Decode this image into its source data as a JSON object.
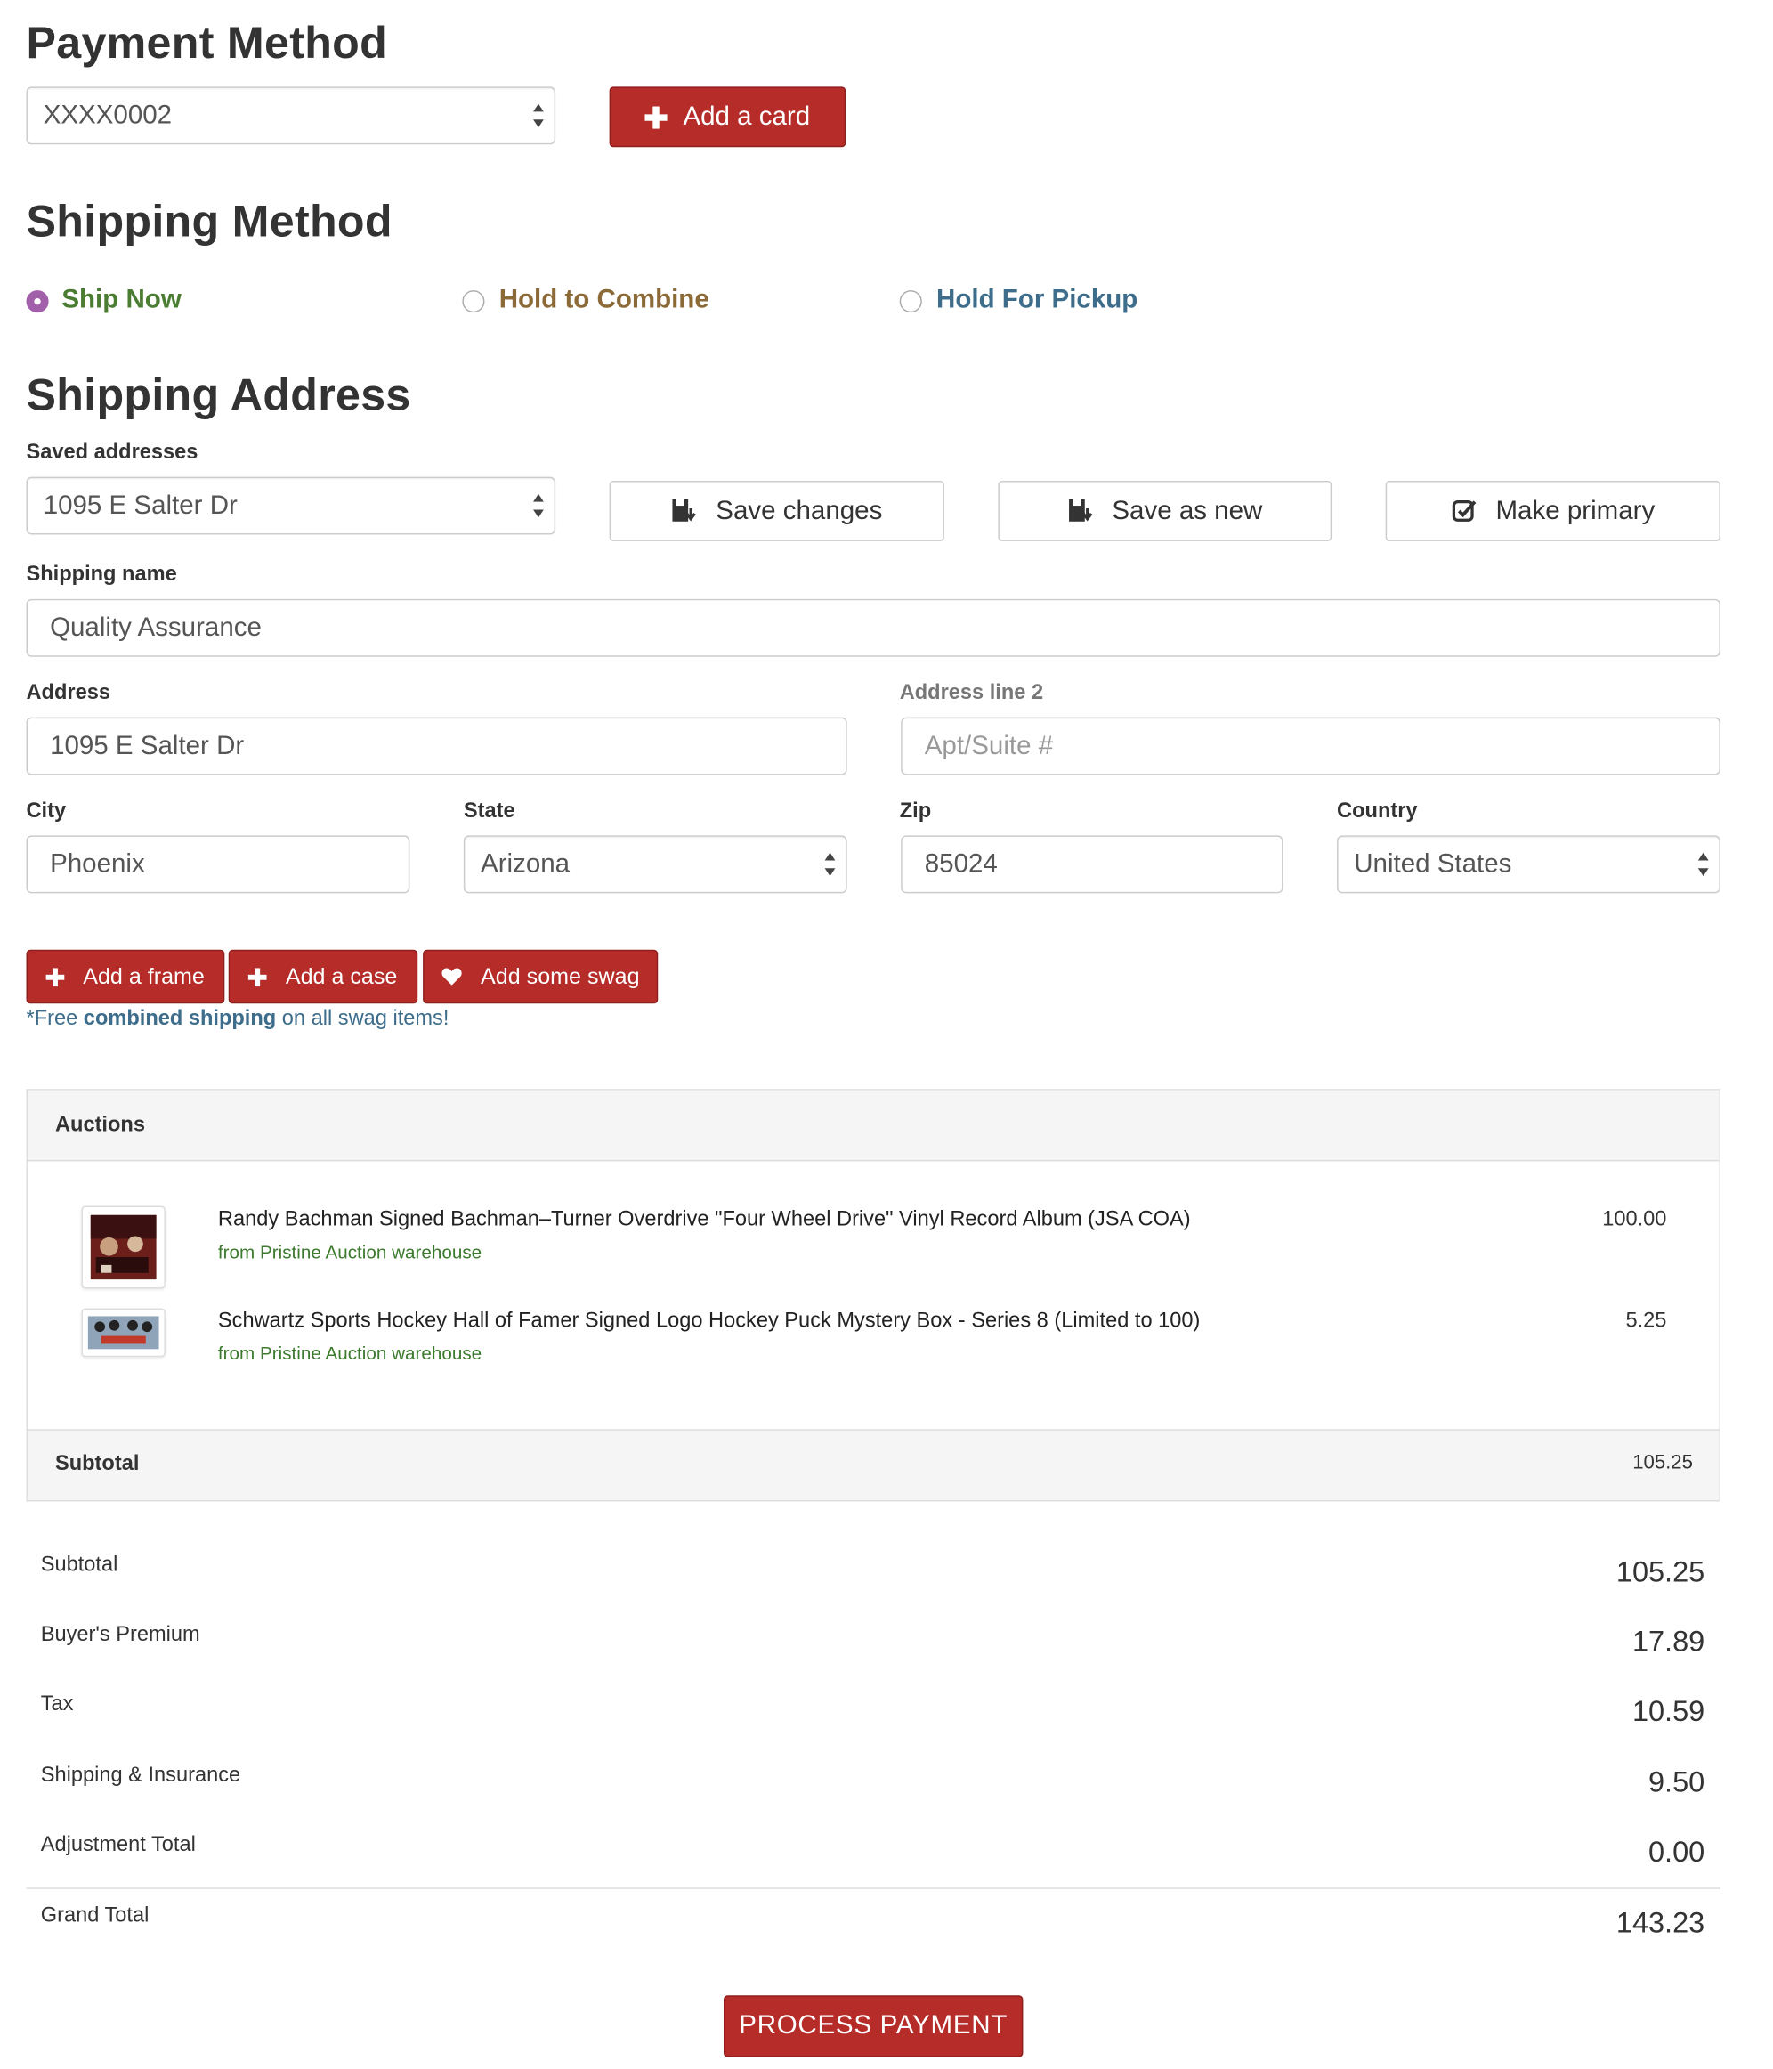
{
  "payment": {
    "title": "Payment Method",
    "card_selected": "XXXX0002",
    "add_card_label": "Add a card"
  },
  "shipping_method": {
    "title": "Shipping Method",
    "options": [
      {
        "label": "Ship Now",
        "color": "#4a7d31",
        "checked": true
      },
      {
        "label": "Hold to Combine",
        "color": "#8c6a37",
        "checked": false
      },
      {
        "label": "Hold For Pickup",
        "color": "#3d6d8b",
        "checked": false
      }
    ]
  },
  "shipping_address": {
    "title": "Shipping Address",
    "saved_label": "Saved addresses",
    "saved_selected": "1095 E Salter Dr",
    "save_changes_label": "Save changes",
    "save_as_new_label": "Save as new",
    "make_primary_label": "Make primary",
    "name_label": "Shipping name",
    "name_value": "Quality Assurance",
    "address_label": "Address",
    "address_value": "1095 E Salter Dr",
    "address2_label": "Address line 2",
    "address2_placeholder": "Apt/Suite #",
    "city_label": "City",
    "city_value": "Phoenix",
    "state_label": "State",
    "state_value": "Arizona",
    "zip_label": "Zip",
    "zip_value": "85024",
    "country_label": "Country",
    "country_value": "United States"
  },
  "addons": {
    "frame_label": "Add a frame",
    "case_label": "Add a case",
    "swag_label": "Add some swag",
    "note_prefix": "*Free ",
    "note_bold": "combined shipping",
    "note_suffix": " on all swag items!"
  },
  "auctions": {
    "heading": "Auctions",
    "items": [
      {
        "title": "Randy Bachman Signed Bachman–Turner Overdrive \"Four Wheel Drive\" Vinyl Record Album (JSA COA)",
        "source": "from Pristine Auction warehouse",
        "price": "100.00"
      },
      {
        "title": "Schwartz Sports Hockey Hall of Famer Signed Logo Hockey Puck Mystery Box - Series 8 (Limited to 100)",
        "source": "from Pristine Auction warehouse",
        "price": "5.25"
      }
    ],
    "subtotal_label": "Subtotal",
    "subtotal_value": "105.25"
  },
  "summary": {
    "rows": [
      {
        "label": "Subtotal",
        "value": "105.25"
      },
      {
        "label": "Buyer's Premium",
        "value": "17.89"
      },
      {
        "label": "Tax",
        "value": "10.59"
      },
      {
        "label": "Shipping & Insurance",
        "value": "9.50"
      },
      {
        "label": "Adjustment Total",
        "value": "0.00"
      }
    ],
    "grand_total_label": "Grand Total",
    "grand_total_value": "143.23"
  },
  "process_payment_label": "PROCESS PAYMENT",
  "colors": {
    "primary_red": "#b52c29",
    "link_blue": "#3d6d8b",
    "green": "#3c7a2e"
  }
}
